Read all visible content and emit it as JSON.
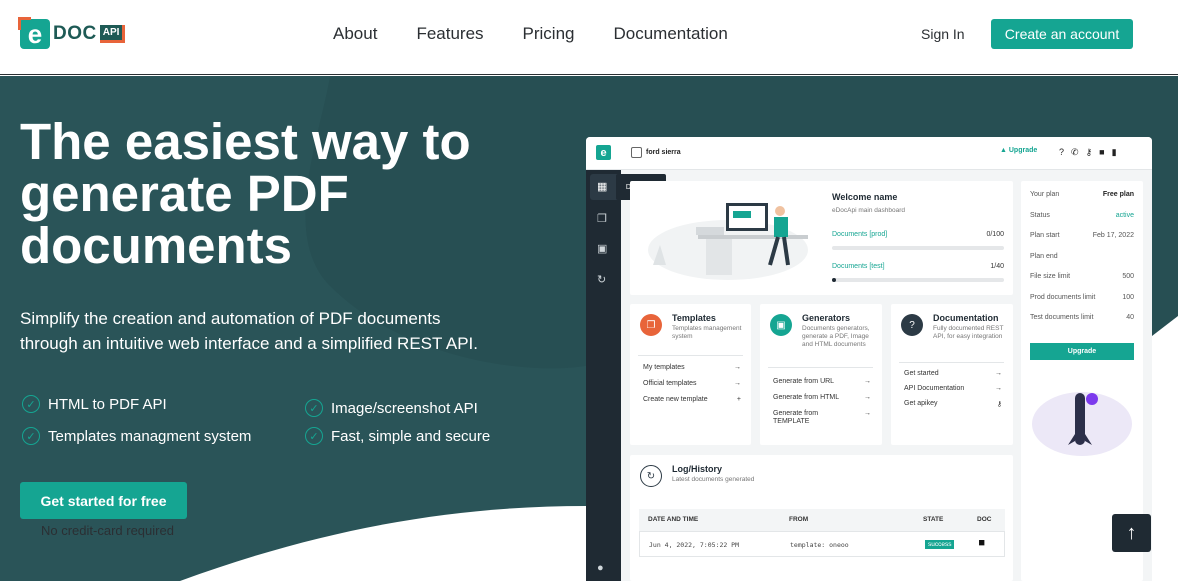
{
  "nav": {
    "logo_main": "DOC",
    "logo_letter": "e",
    "logo_badge": "API",
    "links": [
      "About",
      "Features",
      "Pricing",
      "Documentation"
    ],
    "signin": "Sign In",
    "create_account": "Create an account"
  },
  "hero": {
    "title": "The easiest way to generate PDF documents",
    "subtitle": "Simplify the creation and automation of PDF documents through an intuitive web interface and a simplified REST API.",
    "features": [
      "HTML to PDF API",
      "Image/screenshot API",
      "Templates managment system",
      "Fast, simple and secure"
    ],
    "cta": "Get started for free",
    "cta_note": "No credit-card required"
  },
  "dashboard": {
    "user": "ford sierra",
    "upgrade_link": "Upgrade",
    "sidebar_tooltip": "Dasboard",
    "welcome": {
      "title": "Welcome name",
      "subtitle": "eDocApi main dashboard",
      "prod_label": "Documents [prod]",
      "prod_value": "0/100",
      "prod_fraction": 0,
      "test_label": "Documents [test]",
      "test_value": "1/40",
      "test_fraction": 0.025
    },
    "plan": {
      "rows": [
        {
          "label": "Your plan",
          "value": "Free plan"
        },
        {
          "label": "Status",
          "value": "active"
        },
        {
          "label": "Plan start",
          "value": "Feb 17, 2022"
        },
        {
          "label": "Plan end",
          "value": ""
        },
        {
          "label": "File size limit",
          "value": "500"
        },
        {
          "label": "Prod documents limit",
          "value": "100"
        },
        {
          "label": "Test documents limit",
          "value": "40"
        }
      ],
      "upgrade_button": "Upgrade",
      "status_color": "#15a592"
    },
    "templates": {
      "title": "Templates",
      "subtitle": "Templates management system",
      "links": [
        {
          "label": "My templates",
          "icon": "→"
        },
        {
          "label": "Official templates",
          "icon": "→"
        },
        {
          "label": "Create new template",
          "icon": "+"
        }
      ]
    },
    "generators": {
      "title": "Generators",
      "subtitle": "Documents generators, generate a PDF, Image and HTML documents",
      "links": [
        {
          "label": "Generate from URL",
          "icon": "→"
        },
        {
          "label": "Generate from HTML",
          "icon": "→"
        },
        {
          "label": "Generate from TEMPLATE",
          "icon": "→"
        }
      ]
    },
    "documentation": {
      "title": "Documentation",
      "subtitle": "Fully documented REST API, for easy integration",
      "links": [
        {
          "label": "Get started",
          "icon": "→"
        },
        {
          "label": "API Documentation",
          "icon": "→"
        },
        {
          "label": "Get apikey",
          "icon": "⚷"
        }
      ]
    },
    "log": {
      "title": "Log/History",
      "subtitle": "Latest documents generated",
      "columns": [
        "DATE AND TIME",
        "FROM",
        "STATE",
        "DOC"
      ],
      "rows": [
        {
          "date": "Jun 4, 2022, 7:05:22 PM",
          "from": "template: oneoo",
          "state": "success"
        }
      ]
    }
  }
}
